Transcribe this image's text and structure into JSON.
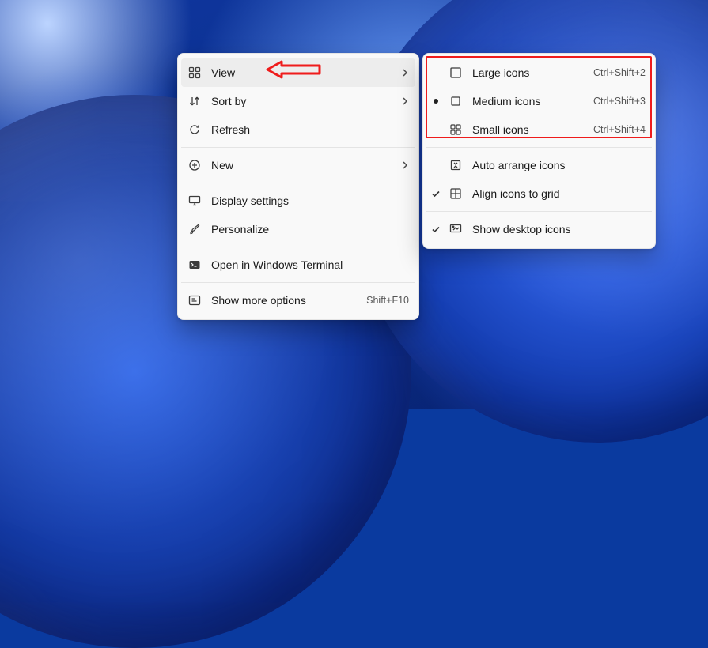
{
  "context_menu": {
    "view": {
      "label": "View",
      "has_submenu": true
    },
    "sort": {
      "label": "Sort by",
      "has_submenu": true
    },
    "refresh": {
      "label": "Refresh"
    },
    "new": {
      "label": "New",
      "has_submenu": true
    },
    "display": {
      "label": "Display settings"
    },
    "personalize": {
      "label": "Personalize"
    },
    "terminal": {
      "label": "Open in Windows Terminal"
    },
    "more": {
      "label": "Show more options",
      "accel": "Shift+F10"
    }
  },
  "view_submenu": {
    "large": {
      "label": "Large icons",
      "accel": "Ctrl+Shift+2"
    },
    "medium": {
      "label": "Medium icons",
      "accel": "Ctrl+Shift+3",
      "selected": true
    },
    "small": {
      "label": "Small icons",
      "accel": "Ctrl+Shift+4"
    },
    "autoarrange": {
      "label": "Auto arrange icons"
    },
    "align": {
      "label": "Align icons to grid",
      "checked": true
    },
    "showdesk": {
      "label": "Show desktop icons",
      "checked": true
    }
  },
  "annotation": {
    "arrow_points_to": "view",
    "red_box_group": "icon-size-options"
  }
}
